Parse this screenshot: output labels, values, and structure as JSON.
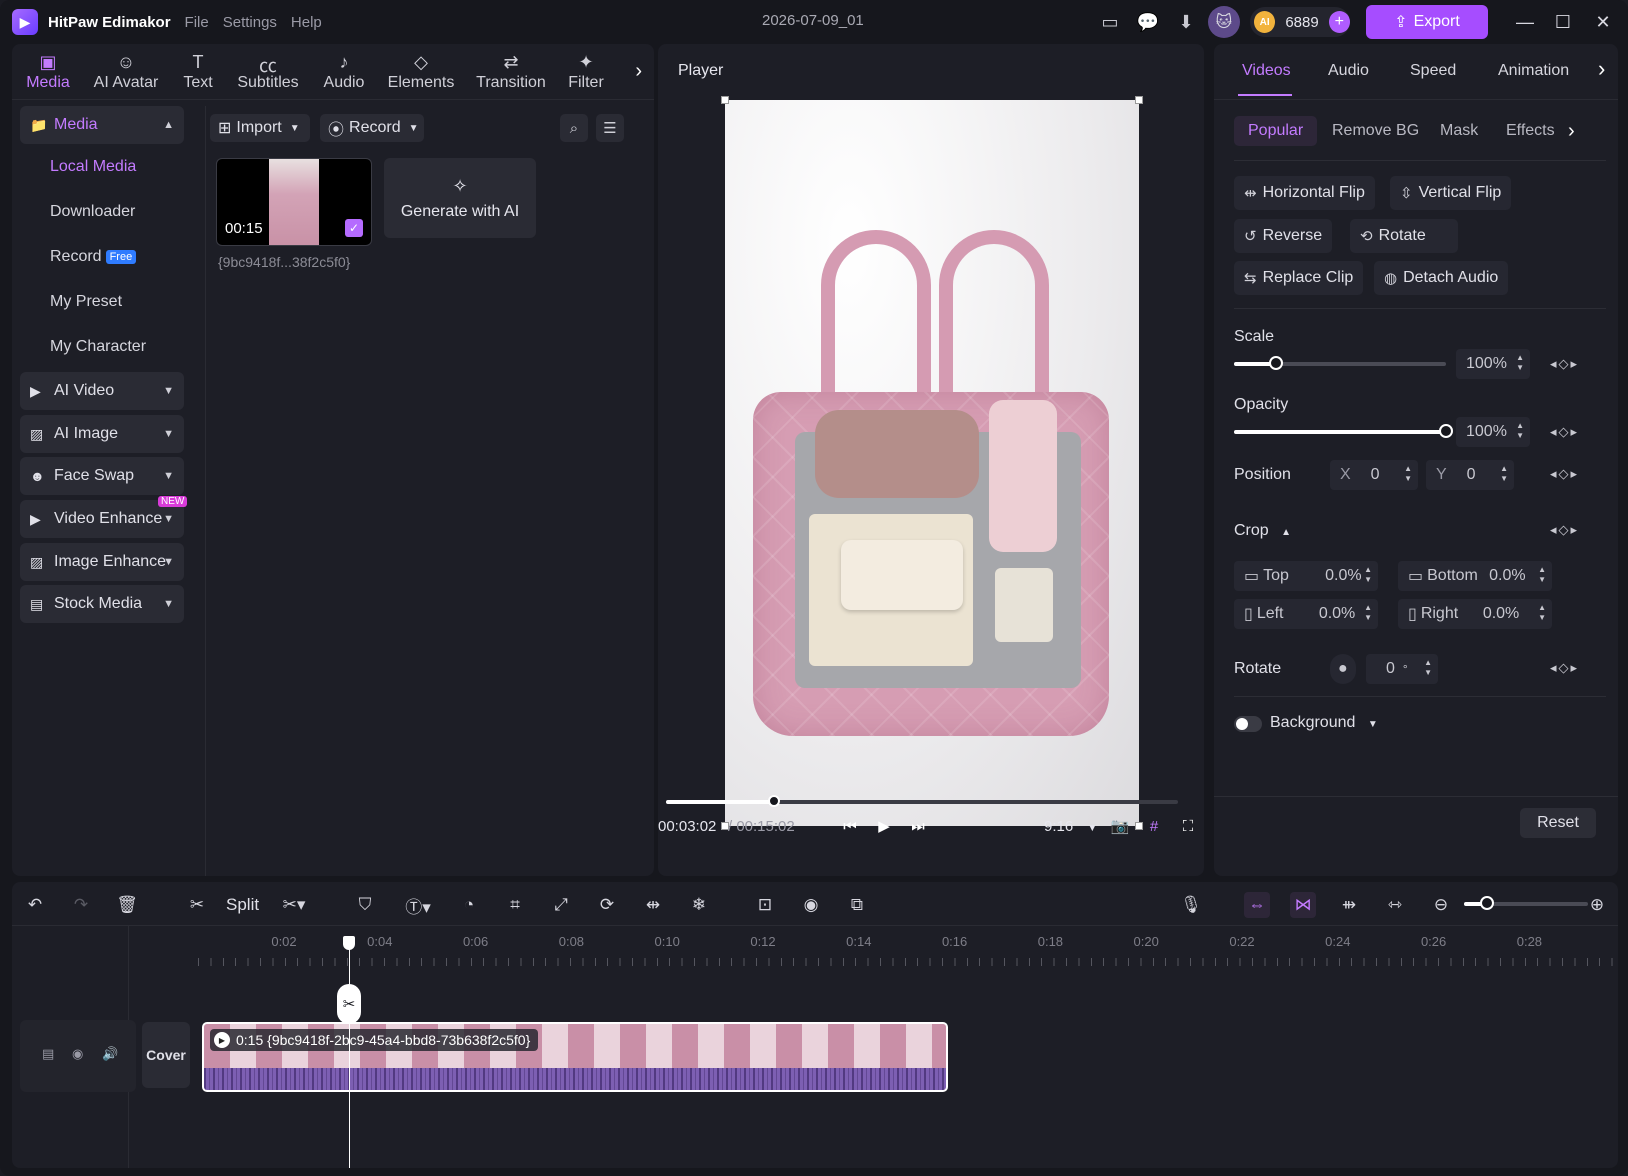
{
  "titlebar": {
    "app_name": "HitPaw Edimakor",
    "menu": [
      "File",
      "Settings",
      "Help"
    ],
    "doc_title": "2026-07-09_01",
    "credits": "6889",
    "export_label": "Export"
  },
  "tool_tabs": [
    {
      "label": "Media",
      "icon": "media-icon"
    },
    {
      "label": "AI Avatar",
      "icon": "avatar-icon"
    },
    {
      "label": "Text",
      "icon": "text-icon"
    },
    {
      "label": "Subtitles",
      "icon": "subtitles-icon"
    },
    {
      "label": "Audio",
      "icon": "audio-icon"
    },
    {
      "label": "Elements",
      "icon": "elements-icon"
    },
    {
      "label": "Transition",
      "icon": "transition-icon"
    },
    {
      "label": "Filter",
      "icon": "filter-icon"
    }
  ],
  "sidebar": {
    "media_head": "Media",
    "sub_items": [
      "Local Media",
      "Downloader",
      "Record",
      "My Preset",
      "My Character"
    ],
    "record_badge": "Free",
    "groups": [
      "AI Video",
      "AI Image",
      "Face Swap",
      "Video Enhance",
      "Image Enhance",
      "Stock Media"
    ],
    "new_badge": "NEW"
  },
  "media": {
    "import_label": "Import",
    "record_label": "Record",
    "thumb_duration": "00:15",
    "thumb_name": "{9bc9418f...38f2c5f0}",
    "generate_label": "Generate with AI"
  },
  "player": {
    "title": "Player",
    "current_time": "00:03:02",
    "total_time": "/ 00:15:02",
    "ratio": "9:16",
    "progress": 0.2
  },
  "right": {
    "tabs": [
      "Videos",
      "Audio",
      "Speed",
      "Animation"
    ],
    "subtabs": [
      "Popular",
      "Remove BG",
      "Mask",
      "Effects"
    ],
    "buttons": {
      "hflip": "Horizontal Flip",
      "vflip": "Vertical Flip",
      "reverse": "Reverse",
      "rotate": "Rotate",
      "replace": "Replace Clip",
      "detach": "Detach Audio"
    },
    "scale_label": "Scale",
    "scale_value": "100%",
    "scale_level": 0.2,
    "opacity_label": "Opacity",
    "opacity_value": "100%",
    "opacity_level": 1.0,
    "position_label": "Position",
    "pos_x_label": "X",
    "pos_x": "0",
    "pos_y_label": "Y",
    "pos_y": "0",
    "crop_label": "Crop",
    "crop_top_label": "Top",
    "crop_top": "0.0%",
    "crop_bottom_label": "Bottom",
    "crop_bottom": "0.0%",
    "crop_left_label": "Left",
    "crop_left": "0.0%",
    "crop_right_label": "Right",
    "crop_right": "0.0%",
    "rotate_label": "Rotate",
    "rotate_value": "0",
    "rotate_unit": "°",
    "background_label": "Background",
    "reset_label": "Reset"
  },
  "timeline": {
    "split_label": "Split",
    "ticks": [
      "0:02",
      "0:04",
      "0:06",
      "0:08",
      "0:10",
      "0:12",
      "0:14",
      "0:16",
      "0:18",
      "0:20",
      "0:22",
      "0:24",
      "0:26",
      "0:28"
    ],
    "cover_label": "Cover",
    "clip_label": "0:15 {9bc9418f-2bc9-45a4-bbd8-73b638f2c5f0}"
  },
  "colors": {
    "accent": "#c37bff",
    "export": "#a64dff",
    "panel": "#1d1e26"
  }
}
